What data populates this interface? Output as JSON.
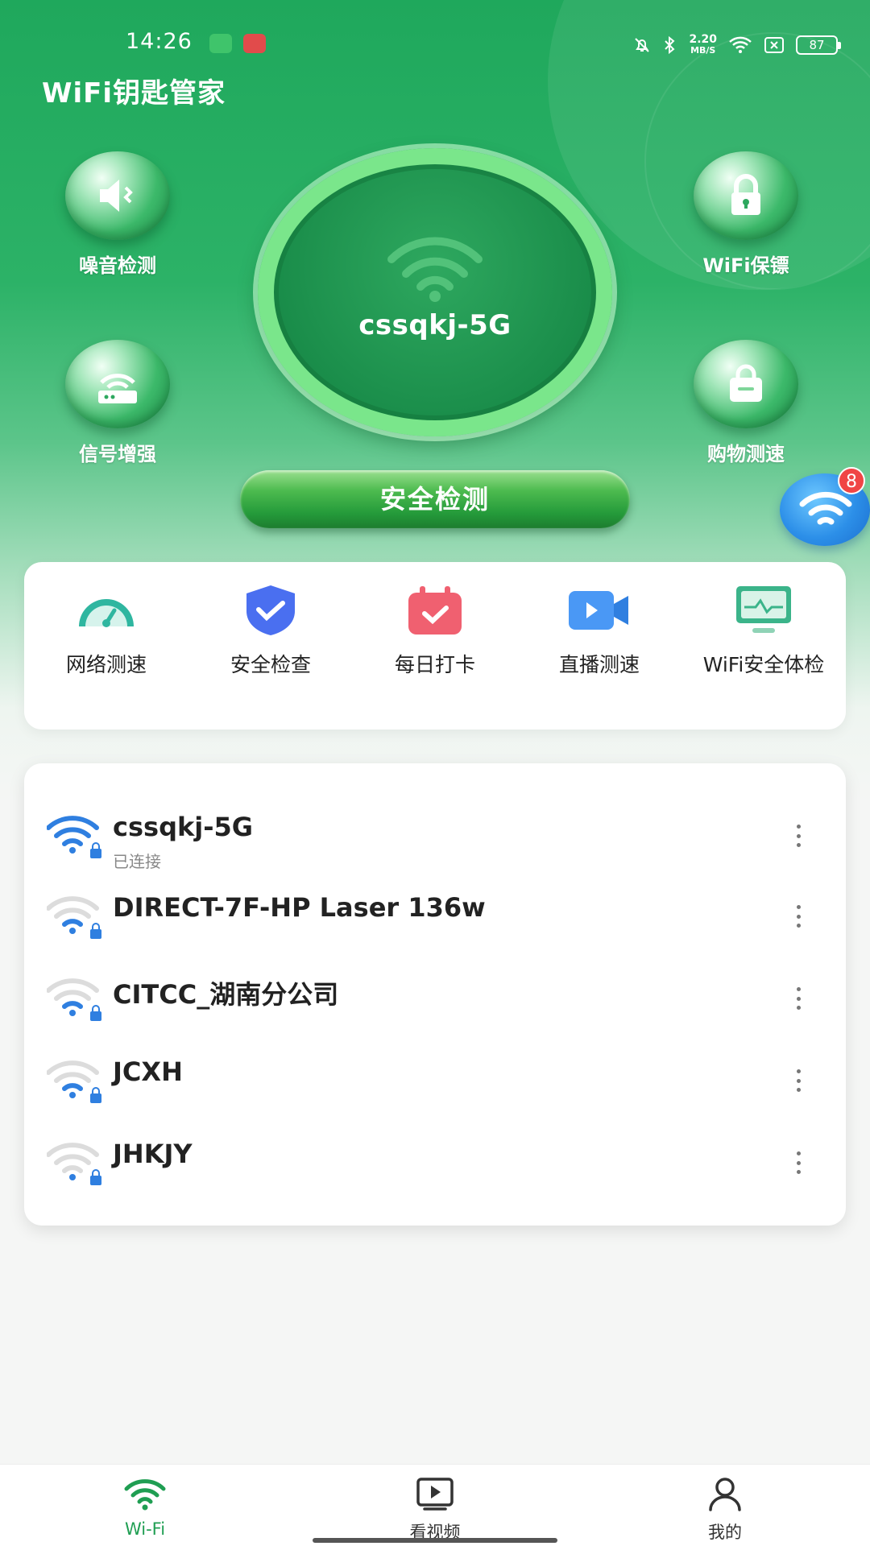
{
  "status_bar": {
    "time": "14:26",
    "net_speed_value": "2.20",
    "net_speed_unit": "MB/S",
    "battery": "87"
  },
  "app": {
    "title": "WiFi钥匙管家"
  },
  "features": {
    "noise": {
      "label": "噪音检测",
      "icon": "speaker-icon"
    },
    "guard": {
      "label": "WiFi保镖",
      "icon": "lock-icon"
    },
    "signal": {
      "label": "信号增强",
      "icon": "router-icon"
    },
    "shopping": {
      "label": "购物测速",
      "icon": "shopping-bag-icon"
    }
  },
  "center": {
    "ssid": "cssqkj-5G",
    "scan_button": "安全检测"
  },
  "floating_button": {
    "badge": "8"
  },
  "tools": [
    {
      "label": "网络测速",
      "icon": "speedometer-icon",
      "color": "#2fb6a0"
    },
    {
      "label": "安全检查",
      "icon": "shield-check-icon",
      "color": "#4a6ff0"
    },
    {
      "label": "每日打卡",
      "icon": "calendar-check-icon",
      "color": "#f06070"
    },
    {
      "label": "直播测速",
      "icon": "video-camera-icon",
      "color": "#3a8df0"
    },
    {
      "label": "WiFi安全体检",
      "icon": "monitor-icon",
      "color": "#3bb48a"
    }
  ],
  "wifi_list": [
    {
      "ssid": "cssqkj-5G",
      "status": "已连接"
    },
    {
      "ssid": "DIRECT-7F-HP Laser 136w"
    },
    {
      "ssid": "CITCC_湖南分公司"
    },
    {
      "ssid": "JCXH"
    },
    {
      "ssid": "JHKJY"
    }
  ],
  "bottom_nav": [
    {
      "label": "Wi-Fi",
      "icon": "wifi-icon",
      "active": true
    },
    {
      "label": "看视频",
      "icon": "play-video-icon",
      "active": false
    },
    {
      "label": "我的",
      "icon": "person-icon",
      "active": false
    }
  ],
  "colors": {
    "brand_green": "#2cb267",
    "active_nav": "#1f9e52",
    "wifi_blue": "#2f7fe0",
    "badge_red": "#f04545"
  }
}
